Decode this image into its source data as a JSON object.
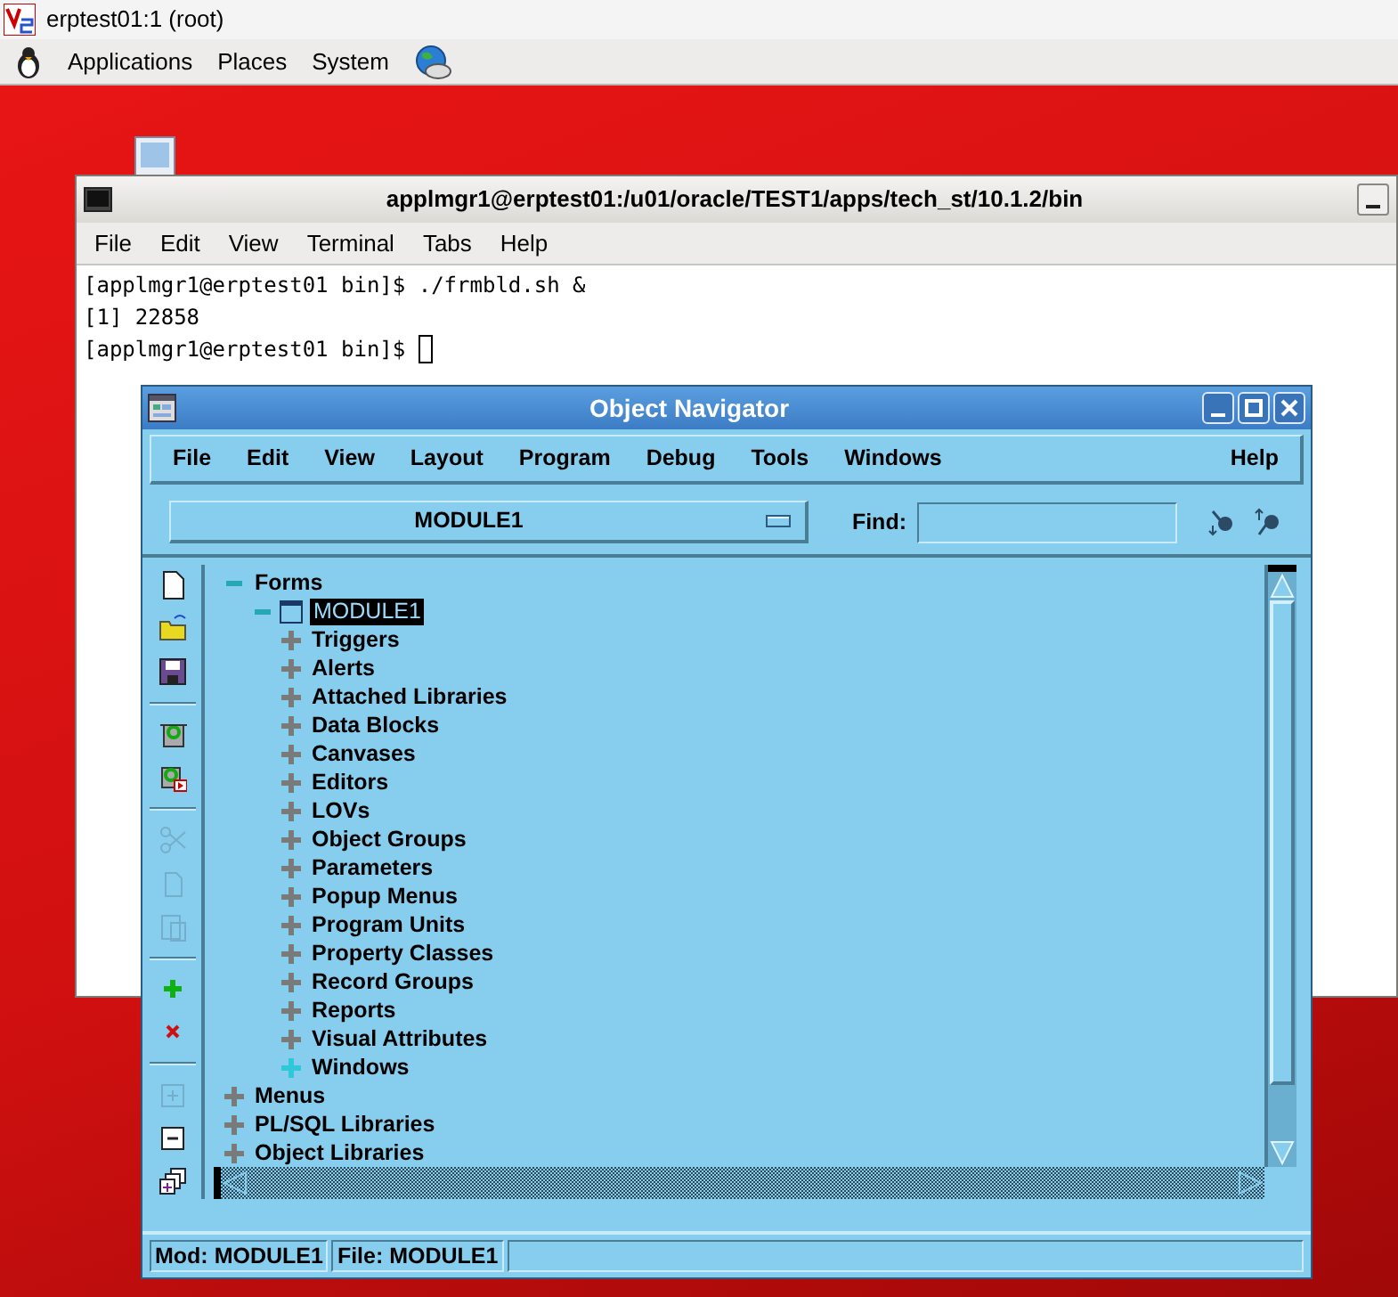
{
  "vnc": {
    "title": "erptest01:1 (root)"
  },
  "panel": {
    "menus": [
      "Applications",
      "Places",
      "System"
    ]
  },
  "terminal": {
    "title": "applmgr1@erptest01:/u01/oracle/TEST1/apps/tech_st/10.1.2/bin",
    "menus": [
      "File",
      "Edit",
      "View",
      "Terminal",
      "Tabs",
      "Help"
    ],
    "lines": [
      "[applmgr1@erptest01 bin]$ ./frmbld.sh &",
      "[1] 22858",
      "[applmgr1@erptest01 bin]$"
    ],
    "cursor_visible": true
  },
  "navigator": {
    "title": "Object Navigator",
    "menus": [
      "File",
      "Edit",
      "View",
      "Layout",
      "Program",
      "Debug",
      "Tools",
      "Windows"
    ],
    "help_menu": "Help",
    "module_select": "MODULE1",
    "find_label": "Find:",
    "toolbar": [
      {
        "kind": "new",
        "disabled": false
      },
      {
        "kind": "open",
        "disabled": false
      },
      {
        "kind": "save",
        "disabled": false
      },
      {
        "kind": "separator"
      },
      {
        "kind": "run",
        "disabled": false
      },
      {
        "kind": "debug",
        "disabled": false
      },
      {
        "kind": "separator"
      },
      {
        "kind": "cut",
        "disabled": true
      },
      {
        "kind": "copy",
        "disabled": true
      },
      {
        "kind": "paste",
        "disabled": true
      },
      {
        "kind": "separator"
      },
      {
        "kind": "create",
        "disabled": false
      },
      {
        "kind": "delete",
        "disabled": false
      },
      {
        "kind": "separator"
      },
      {
        "kind": "expand",
        "disabled": true
      },
      {
        "kind": "collapse",
        "disabled": false
      },
      {
        "kind": "expand_all",
        "disabled": false
      }
    ],
    "tree": [
      {
        "label": "Forms",
        "kind": "category",
        "expanded": true,
        "populated": true,
        "selected": false,
        "children": [
          {
            "label": "MODULE1",
            "kind": "module",
            "expanded": true,
            "populated": true,
            "selected": true,
            "children": [
              {
                "label": "Triggers",
                "kind": "category",
                "expanded": false,
                "populated": false,
                "selected": false
              },
              {
                "label": "Alerts",
                "kind": "category",
                "expanded": false,
                "populated": false,
                "selected": false
              },
              {
                "label": "Attached Libraries",
                "kind": "category",
                "expanded": false,
                "populated": false,
                "selected": false
              },
              {
                "label": "Data Blocks",
                "kind": "category",
                "expanded": false,
                "populated": false,
                "selected": false
              },
              {
                "label": "Canvases",
                "kind": "category",
                "expanded": false,
                "populated": false,
                "selected": false
              },
              {
                "label": "Editors",
                "kind": "category",
                "expanded": false,
                "populated": false,
                "selected": false
              },
              {
                "label": "LOVs",
                "kind": "category",
                "expanded": false,
                "populated": false,
                "selected": false
              },
              {
                "label": "Object Groups",
                "kind": "category",
                "expanded": false,
                "populated": false,
                "selected": false
              },
              {
                "label": "Parameters",
                "kind": "category",
                "expanded": false,
                "populated": false,
                "selected": false
              },
              {
                "label": "Popup Menus",
                "kind": "category",
                "expanded": false,
                "populated": false,
                "selected": false
              },
              {
                "label": "Program Units",
                "kind": "category",
                "expanded": false,
                "populated": false,
                "selected": false
              },
              {
                "label": "Property Classes",
                "kind": "category",
                "expanded": false,
                "populated": false,
                "selected": false
              },
              {
                "label": "Record Groups",
                "kind": "category",
                "expanded": false,
                "populated": false,
                "selected": false
              },
              {
                "label": "Reports",
                "kind": "category",
                "expanded": false,
                "populated": false,
                "selected": false
              },
              {
                "label": "Visual Attributes",
                "kind": "category",
                "expanded": false,
                "populated": false,
                "selected": false
              },
              {
                "label": "Windows",
                "kind": "category",
                "expanded": false,
                "populated": true,
                "selected": false
              }
            ]
          }
        ]
      },
      {
        "label": "Menus",
        "kind": "category",
        "expanded": false,
        "populated": false,
        "selected": false
      },
      {
        "label": "PL/SQL Libraries",
        "kind": "category",
        "expanded": false,
        "populated": false,
        "selected": false
      },
      {
        "label": "Object Libraries",
        "kind": "category",
        "expanded": false,
        "populated": false,
        "selected": false
      }
    ],
    "status": [
      "Mod: MODULE1",
      "File: MODULE1"
    ]
  }
}
